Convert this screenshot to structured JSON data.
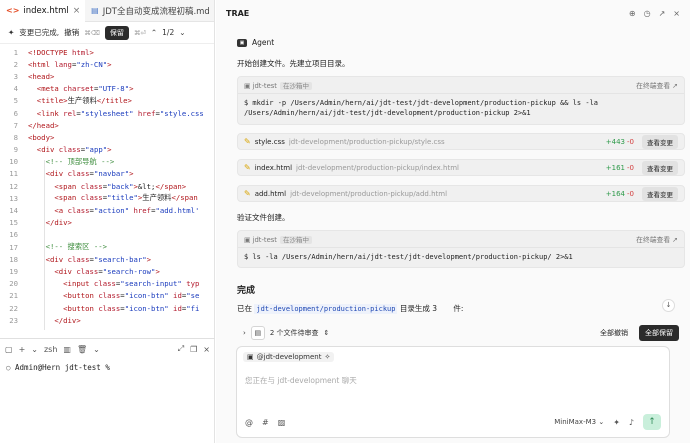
{
  "editor": {
    "tabs": [
      {
        "label": "index.html",
        "icon": "html-file-icon"
      },
      {
        "label": "JDT全自动变成流程初稿.md",
        "icon": "markdown-file-icon"
      }
    ],
    "toolbar": {
      "changes_label": "变更已完成,",
      "undo_label": "撤销",
      "undo_kbd": "⌘⌫",
      "keep_label": "保留",
      "keep_kbd": "⌘⏎",
      "counter": "1/2"
    },
    "lines": [
      {
        "n": "1",
        "html": "<span class='t'>&lt;!DOCTYPE</span> <span class='a'>html</span><span class='t'>&gt;</span>"
      },
      {
        "n": "2",
        "html": "<span class='t'>&lt;html</span> <span class='a'>lang</span>=<span class='s'>\"zh-CN\"</span><span class='t'>&gt;</span>"
      },
      {
        "n": "3",
        "html": "<span class='t'>&lt;head&gt;</span>"
      },
      {
        "n": "4",
        "html": "  <span class='t'>&lt;meta</span> <span class='a'>charset</span>=<span class='s'>\"UTF-8\"</span><span class='t'>&gt;</span>"
      },
      {
        "n": "5",
        "html": "  <span class='t'>&lt;title&gt;</span>生产领料<span class='t'>&lt;/title&gt;</span>"
      },
      {
        "n": "6",
        "html": "  <span class='t'>&lt;link</span> <span class='a'>rel</span>=<span class='s'>\"stylesheet\"</span> <span class='a'>href</span>=<span class='s'>\"style.css</span>"
      },
      {
        "n": "7",
        "html": "<span class='t'>&lt;/head&gt;</span>"
      },
      {
        "n": "8",
        "html": "<span class='t'>&lt;body&gt;</span>"
      },
      {
        "n": "9",
        "html": "  <span class='t'>&lt;div</span> <span class='a'>class</span>=<span class='s'>\"app\"</span><span class='t'>&gt;</span>"
      },
      {
        "n": "10",
        "html": "    <span class='c'>&lt;!-- 顶部导航 --&gt;</span>"
      },
      {
        "n": "11",
        "html": "    <span class='t'>&lt;div</span> <span class='a'>class</span>=<span class='s'>\"navbar\"</span><span class='t'>&gt;</span>"
      },
      {
        "n": "12",
        "html": "      <span class='t'>&lt;span</span> <span class='a'>class</span>=<span class='s'>\"back\"</span><span class='t'>&gt;</span>&amp;lt;<span class='t'>&lt;/span&gt;</span>"
      },
      {
        "n": "13",
        "html": "      <span class='t'>&lt;span</span> <span class='a'>class</span>=<span class='s'>\"title\"</span><span class='t'>&gt;</span>生产领料<span class='t'>&lt;/span</span>"
      },
      {
        "n": "14",
        "html": "      <span class='t'>&lt;a</span> <span class='a'>class</span>=<span class='s'>\"action\"</span> <span class='a'>href</span>=<span class='s'>\"add.html'</span>"
      },
      {
        "n": "15",
        "html": "    <span class='t'>&lt;/div&gt;</span>"
      },
      {
        "n": "16",
        "html": ""
      },
      {
        "n": "17",
        "html": "    <span class='c'>&lt;!-- 搜索区 --&gt;</span>"
      },
      {
        "n": "18",
        "html": "    <span class='t'>&lt;div</span> <span class='a'>class</span>=<span class='s'>\"search-bar\"</span><span class='t'>&gt;</span>"
      },
      {
        "n": "19",
        "html": "      <span class='t'>&lt;div</span> <span class='a'>class</span>=<span class='s'>\"search-row\"</span><span class='t'>&gt;</span>"
      },
      {
        "n": "20",
        "html": "        <span class='t'>&lt;input</span> <span class='a'>class</span>=<span class='s'>\"search-input\"</span> <span class='a'>typ</span>"
      },
      {
        "n": "21",
        "html": "        <span class='t'>&lt;button</span> <span class='a'>class</span>=<span class='s'>\"icon-btn\"</span> <span class='a'>id</span>=<span class='s'>\"se</span>"
      },
      {
        "n": "22",
        "html": "        <span class='t'>&lt;button</span> <span class='a'>class</span>=<span class='s'>\"icon-btn\"</span> <span class='a'>id</span>=<span class='s'>\"fi</span>"
      },
      {
        "n": "23",
        "html": "      <span class='t'>&lt;/div&gt;</span>"
      }
    ]
  },
  "terminal": {
    "shell": "zsh",
    "prompt": "Admin@Hern jdt-test %"
  },
  "panel": {
    "title": "TRAE",
    "agent_label": "Agent",
    "intro": "开始创建文件。先建立项目目录。",
    "cmd1": {
      "name": "jdt-test",
      "badge": "在沙箱中",
      "open_label": "在终端查看",
      "text_line1": "$ mkdir -p /Users/Admin/hern/ai/jdt-test/jdt-development/production-pickup && ls -la",
      "text_line2": "/Users/Admin/hern/ai/jdt-test/jdt-development/production-pickup 2>&1"
    },
    "files": [
      {
        "name": "style.css",
        "path": "jdt-development/production-pickup/style.css",
        "plus": "+443",
        "minus": "-0"
      },
      {
        "name": "index.html",
        "path": "jdt-development/production-pickup/index.html",
        "plus": "+161",
        "minus": "-0"
      },
      {
        "name": "add.html",
        "path": "jdt-development/production-pickup/add.html",
        "plus": "+164",
        "minus": "-0"
      }
    ],
    "view_change_label": "查看变更",
    "verify_text": "验证文件创建。",
    "cmd2": {
      "name": "jdt-test",
      "badge": "在沙箱中",
      "open_label": "在终端查看",
      "text_line1": "$ ls -la /Users/Admin/hern/ai/jdt-test/jdt-development/production-pickup/ 2>&1"
    },
    "done_title": "完成",
    "done_prefix": "已在",
    "done_path": "jdt-development/production-pickup",
    "done_suffix": "目录生成 3",
    "done_tail": "件:",
    "changes_bar": {
      "pending": "2 个文件待审查",
      "undo_all": "全部撤销",
      "keep_all": "全部保留"
    },
    "input": {
      "context": "@jdt-development",
      "placeholder": "您正在与 jdt-development 聊天",
      "model": "MiniMax-M3"
    }
  }
}
